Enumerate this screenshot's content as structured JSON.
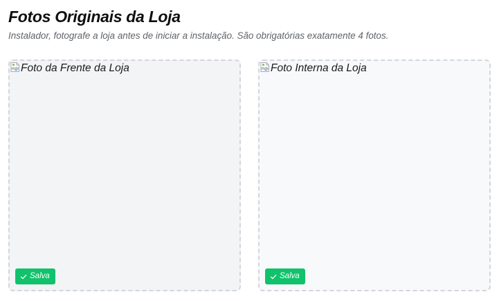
{
  "header": {
    "title": "Fotos Originais da Loja",
    "subtitle": "Instalador, fotografe a loja antes de iniciar a instalação. São obrigatórias exatamente 4 fotos."
  },
  "photos": [
    {
      "alt": "Foto da Frente da Loja",
      "image_icon": "broken-image-icon",
      "badge_icon": "check-icon",
      "badge_label": "Salva"
    },
    {
      "alt": "Foto Interna da Loja",
      "image_icon": "broken-image-icon",
      "badge_icon": "check-icon",
      "badge_label": "Salva"
    }
  ],
  "colors": {
    "badge_background": "#10c26b",
    "card_border": "#d3d6dc",
    "card_background": "#f3f4f6"
  }
}
